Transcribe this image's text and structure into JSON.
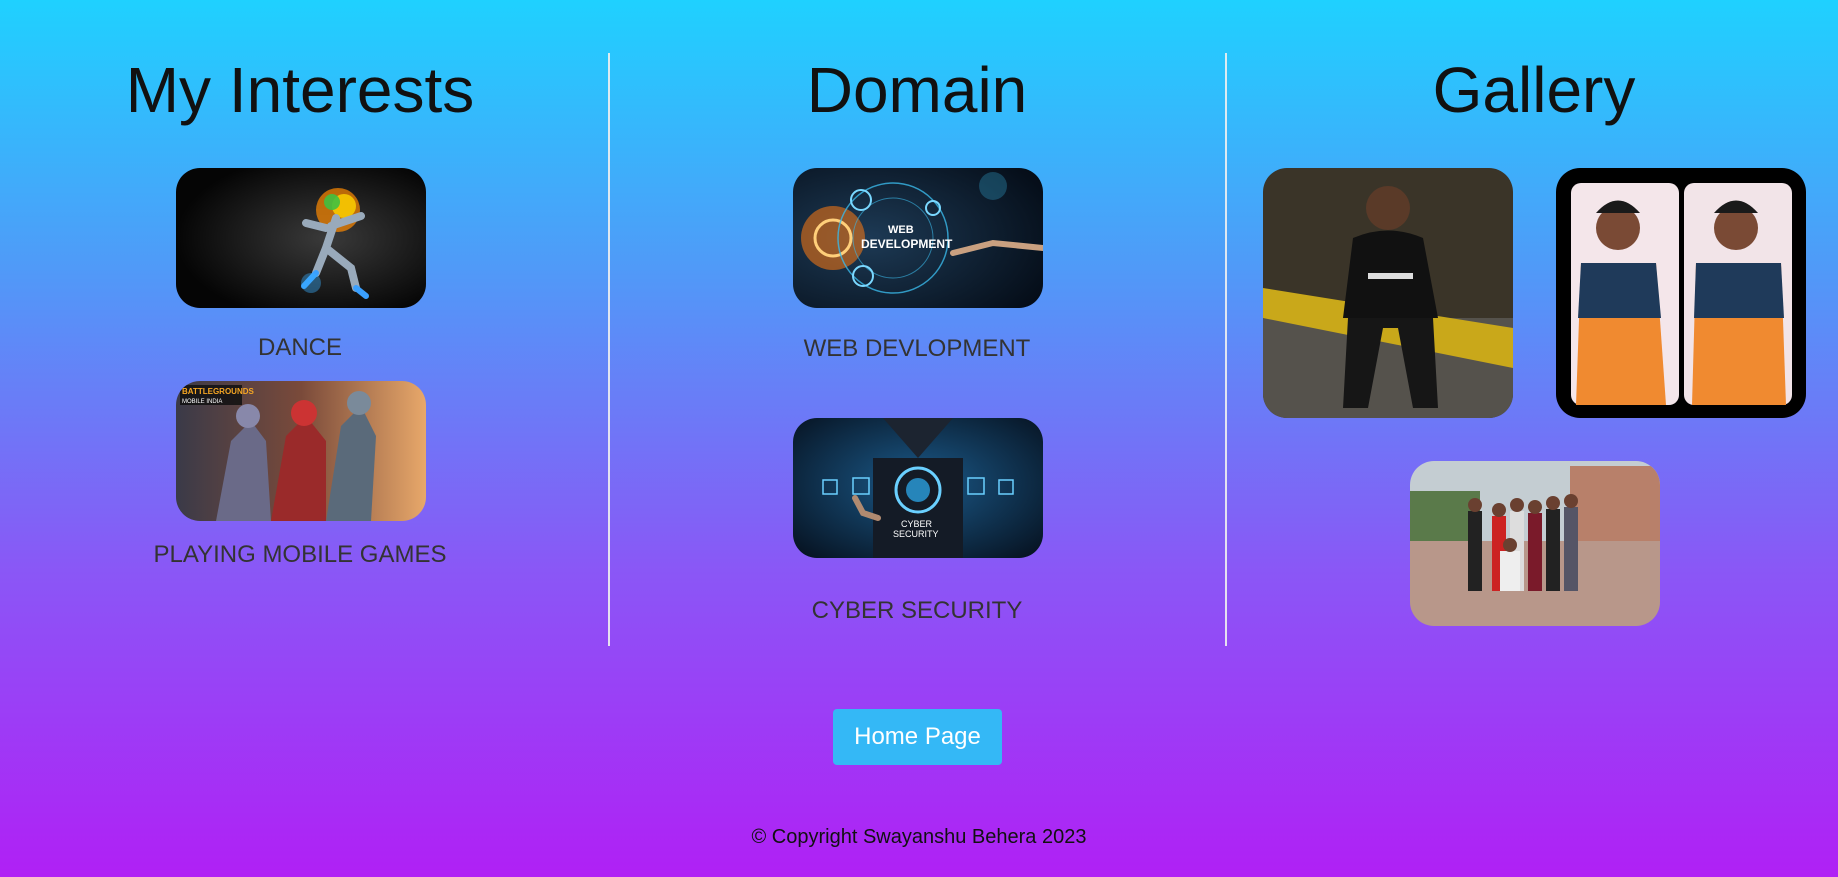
{
  "interests": {
    "title": "My Interests",
    "items": [
      {
        "label": "DANCE",
        "image": "dance-image"
      },
      {
        "label": "PLAYING MOBILE GAMES",
        "image": "battlegrounds-mobile-image"
      }
    ],
    "game_logo_line1": "BATTLEGROUNDS",
    "game_logo_line2": "MOBILE INDIA"
  },
  "domain": {
    "title": "Domain",
    "items": [
      {
        "label": "WEB DEVLOPMENT",
        "image_text_1": "WEB",
        "image_text_2": "DEVELOPMENT"
      },
      {
        "label": "CYBER SECURITY",
        "image_text_1": "CYBER",
        "image_text_2": "SECURITY"
      }
    ]
  },
  "gallery": {
    "title": "Gallery",
    "photos": [
      "person-sitting-photo",
      "two-selfies-photo",
      "group-photo"
    ]
  },
  "home_button": {
    "label": "Home Page"
  },
  "footer": {
    "text": "© Copyright Swayanshu Behera 2023"
  },
  "colors": {
    "gradient_top": "#1fd1ff",
    "gradient_bottom": "#b020f5",
    "button_bg": "#34b8f6",
    "divider": "#f0f0f0"
  }
}
